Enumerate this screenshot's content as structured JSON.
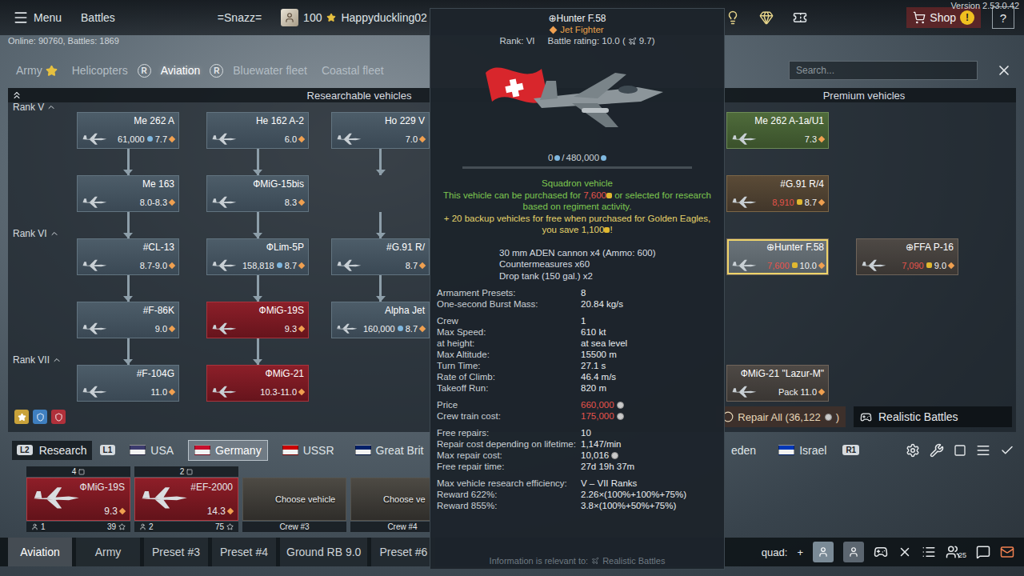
{
  "topbar": {
    "menu": "Menu",
    "battles": "Battles",
    "squadron_tag": "=Snazz=",
    "level": "100",
    "username": "Happyduckling02",
    "shop": "Shop",
    "shop_alert": "!",
    "help": "?",
    "version": "Version 2.53.0.42"
  },
  "online": "Online: 90760, Battles: 1869",
  "tabs": [
    {
      "label": "Army",
      "selected": false,
      "starred": true
    },
    {
      "label": "Helicopters",
      "selected": false,
      "starred": false
    },
    {
      "label": "Aviation",
      "selected": true,
      "starred": false
    },
    {
      "label": "Bluewater fleet",
      "selected": false,
      "starred": false
    },
    {
      "label": "Coastal fleet",
      "selected": false,
      "starred": false
    }
  ],
  "tab_keys": [
    "R",
    "R"
  ],
  "search": {
    "placeholder": "Search..."
  },
  "tree": {
    "researchable_title": "Researchable vehicles",
    "premium_title": "Premium vehicles",
    "rows": [
      {
        "rank": "Rank V",
        "researchable": [
          {
            "name": "Me 262 A",
            "price": "61,000",
            "currency": "rp",
            "br": "7.7",
            "tone": "default",
            "selected": false
          },
          {
            "name": "He 162 A-2",
            "price": null,
            "currency": "none",
            "br": "6.0",
            "tone": "default",
            "selected": false
          },
          {
            "name": "Ho 229 V",
            "price": null,
            "currency": "none",
            "br": "7.0",
            "tone": "default",
            "selected": false
          }
        ],
        "premium": [
          {
            "name": "Me 262 A-1a/U1",
            "price": null,
            "currency": "none",
            "br": "7.3",
            "tone": "green",
            "selected": false
          },
          null
        ]
      },
      {
        "rank": null,
        "researchable": [
          {
            "name": "Me 163",
            "price": null,
            "currency": "none",
            "br": "8.0-8.3",
            "tone": "default",
            "selected": false
          },
          {
            "name": "ФMiG-15bis",
            "price": null,
            "currency": "none",
            "br": "8.3",
            "tone": "default",
            "selected": false
          },
          null
        ],
        "premium": [
          {
            "name": "#G.91 R/4",
            "price": "8,910",
            "currency": "eagle",
            "br": "8.7",
            "tone": "gold",
            "selected": false
          },
          null
        ]
      },
      {
        "rank": "Rank VI",
        "researchable": [
          {
            "name": "#CL-13",
            "price": null,
            "currency": "none",
            "br": "8.7-9.0",
            "tone": "default",
            "selected": false
          },
          {
            "name": "ФLim-5P",
            "price": "158,818",
            "currency": "rp",
            "br": "8.7",
            "tone": "default",
            "selected": false
          },
          {
            "name": "#G.91 R/",
            "price": null,
            "currency": "none",
            "br": "8.7",
            "tone": "default",
            "selected": false
          }
        ],
        "premium": [
          {
            "name": "⊕Hunter F.58",
            "price": "7,600",
            "currency": "eagle",
            "br": "10.0",
            "tone": "premium",
            "selected": true
          },
          {
            "name": "⊕FFA P-16",
            "price": "7,090",
            "currency": "eagle",
            "br": "9.0",
            "tone": "premium",
            "selected": false
          }
        ]
      },
      {
        "rank": null,
        "researchable": [
          {
            "name": "#F-86K",
            "price": null,
            "currency": "none",
            "br": "9.0",
            "tone": "default",
            "selected": false
          },
          {
            "name": "ФMiG-19S",
            "price": null,
            "currency": "none",
            "br": "9.3",
            "tone": "owned",
            "selected": false
          },
          {
            "name": "Alpha Jet",
            "price": "160,000",
            "currency": "rp",
            "br": "8.7",
            "tone": "default",
            "selected": false
          }
        ],
        "premium": [
          null,
          null
        ]
      },
      {
        "rank": "Rank VII",
        "researchable": [
          {
            "name": "#F-104G",
            "price": null,
            "currency": "none",
            "br": "11.0",
            "tone": "default",
            "selected": false
          },
          {
            "name": "ФMiG-21",
            "price": null,
            "currency": "none",
            "br": "10.3-11.0",
            "tone": "owned",
            "selected": false
          },
          null
        ],
        "premium": [
          {
            "name": "ФMiG-21 \"Lazur-M\"",
            "price": "Pack",
            "currency": "none",
            "br": "11.0",
            "tone": "premium",
            "selected": false
          },
          null
        ]
      }
    ]
  },
  "tree_footer": {
    "repair_label": "Repair All (36,122",
    "repair_suffix": ")",
    "mode": "Realistic Battles"
  },
  "nations": {
    "research_key": "L2",
    "research": "Research",
    "left_key": "L1",
    "right_key": "R1",
    "left": [
      {
        "label": "USA",
        "selected": false,
        "color": "#3c3b6e",
        "show_flag": true
      },
      {
        "label": "Germany",
        "selected": true,
        "color": "#c8102e",
        "show_flag": true
      },
      {
        "label": "USSR",
        "selected": false,
        "color": "#cc0000",
        "show_flag": true
      },
      {
        "label": "Great Brit",
        "selected": false,
        "color": "#012169",
        "show_flag": true
      }
    ],
    "right": [
      {
        "label": "eden",
        "selected": false,
        "color": "#006aa7",
        "show_flag": false
      },
      {
        "label": "Israel",
        "selected": false,
        "color": "#0038b8",
        "show_flag": true
      }
    ]
  },
  "crew": [
    {
      "kind": "vehicle",
      "count": "4",
      "name": "ФMiG-19S",
      "br": "9.3",
      "crew": "1",
      "points": "39",
      "label": ""
    },
    {
      "kind": "vehicle",
      "count": "2",
      "name": "#EF-2000",
      "br": "14.3",
      "crew": "2",
      "points": "75",
      "label": ""
    },
    {
      "kind": "empty",
      "count": "",
      "name": "",
      "br": "",
      "crew": "Crew #3",
      "points": "",
      "label": "Choose vehicle"
    },
    {
      "kind": "empty",
      "count": "",
      "name": "",
      "br": "",
      "crew": "Crew #4",
      "points": "",
      "label": "Choose ve"
    }
  ],
  "presets": [
    {
      "label": "Aviation",
      "selected": true
    },
    {
      "label": "Army",
      "selected": false
    },
    {
      "label": "Preset #3",
      "selected": false
    },
    {
      "label": "Preset #4",
      "selected": false
    },
    {
      "label": "Ground RB 9.0",
      "selected": false
    },
    {
      "label": "Preset #6",
      "selected": false
    }
  ],
  "squad": {
    "label": "quad:",
    "add": "+",
    "friends_count": "25"
  },
  "tooltip": {
    "title": "⊕Hunter F.58",
    "role": "Jet Fighter",
    "rank": "Rank: VI",
    "battle_rating": "Battle rating: 10.0 (",
    "alt_rating": "9.7)",
    "progress": {
      "current": "0",
      "separator": " / ",
      "total": "480,000",
      "level": 0
    },
    "status": "Squadron vehicle",
    "purchase": {
      "before": "This vehicle can be purchased for ",
      "price": "7,600",
      "after": " or selected for research based on regiment activity."
    },
    "backup": {
      "before": "+ 20 backup vehicles for free when purchased for Golden Eagles, you save ",
      "amount": "1,100",
      "after": "!"
    },
    "weapons": [
      "30 mm ADEN cannon x4 (Ammo: 600)",
      "Countermeasures x60",
      "Drop tank (150 gal.) x2"
    ],
    "stats": [
      [
        {
          "label": "Armament Presets:",
          "value": "8",
          "tone": "normal",
          "lion": false
        },
        {
          "label": "One-second Burst Mass:",
          "value": "20.84 kg/s",
          "tone": "normal",
          "lion": false
        }
      ],
      [
        {
          "label": "Crew",
          "value": "1",
          "tone": "normal",
          "lion": false
        },
        {
          "label": "Max Speed:",
          "value": "610 kt",
          "tone": "normal",
          "lion": false
        },
        {
          "label": "at height:",
          "value": "at sea level",
          "tone": "normal",
          "lion": false
        },
        {
          "label": "Max Altitude:",
          "value": "15500 m",
          "tone": "normal",
          "lion": false
        },
        {
          "label": "Turn Time:",
          "value": "27.1 s",
          "tone": "normal",
          "lion": false
        },
        {
          "label": "Rate of Climb:",
          "value": "46.4 m/s",
          "tone": "normal",
          "lion": false
        },
        {
          "label": "Takeoff Run:",
          "value": "820 m",
          "tone": "normal",
          "lion": false
        }
      ],
      [
        {
          "label": "Price",
          "value": "660,000",
          "tone": "red",
          "lion": true
        },
        {
          "label": "Crew train cost:",
          "value": "175,000",
          "tone": "red",
          "lion": true
        }
      ],
      [
        {
          "label": "Free repairs:",
          "value": "10",
          "tone": "normal",
          "lion": false
        },
        {
          "label": "Repair cost depending on lifetime:",
          "value": "1,147/min",
          "tone": "normal",
          "lion": false
        },
        {
          "label": "Max repair cost:",
          "value": "10,016",
          "tone": "normal",
          "lion": true
        },
        {
          "label": "Free repair time:",
          "value": "27d 19h 37m",
          "tone": "normal",
          "lion": false
        }
      ],
      [
        {
          "label": "Max vehicle research efficiency:",
          "value": "V – VII Ranks",
          "tone": "normal",
          "lion": false
        },
        {
          "label": "Reward 622%:",
          "value": "2.26×(100%+100%+75%)",
          "tone": "normal",
          "lion": false
        },
        {
          "label": "Reward 855%:",
          "value": "3.8×(100%+50%+75%)",
          "tone": "normal",
          "lion": false
        }
      ]
    ],
    "footer_label": "Information is relevant to:",
    "footer_mode": "Realistic Battles"
  }
}
